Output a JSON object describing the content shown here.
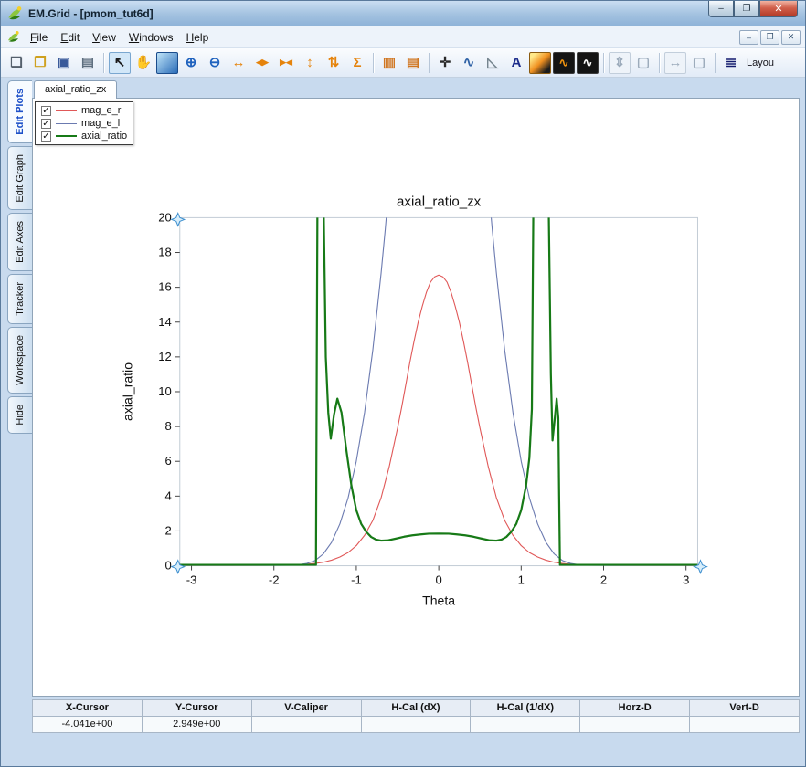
{
  "window": {
    "title": "EM.Grid - [pmom_tut6d]",
    "controls": {
      "minimize": "–",
      "maximize": "❐",
      "close": "✕"
    }
  },
  "child_controls": {
    "minimize": "–",
    "restore": "❐",
    "close": "✕"
  },
  "menu": {
    "items": [
      "File",
      "Edit",
      "View",
      "Windows",
      "Help"
    ]
  },
  "toolbar": {
    "icons": [
      {
        "name": "new-file",
        "glyph": "❏",
        "color": "#55606c"
      },
      {
        "name": "open-folder",
        "glyph": "❐",
        "color": "#cfa11f"
      },
      {
        "name": "save-file",
        "glyph": "▣",
        "color": "#3a5a9a"
      },
      {
        "name": "print",
        "glyph": "▤",
        "color": "#5e6e7e",
        "sep_after": true
      },
      {
        "name": "select-cursor",
        "glyph": "↖",
        "color": "#1c1c1c",
        "selected": true
      },
      {
        "name": "pan-hand",
        "glyph": "✋",
        "color": "#cc8b35"
      },
      {
        "name": "zoom-window",
        "glyph": "",
        "bluebox": true
      },
      {
        "name": "zoom-in",
        "glyph": "⊕",
        "color": "#1f62be"
      },
      {
        "name": "zoom-out",
        "glyph": "⊖",
        "color": "#1f62be"
      },
      {
        "name": "expand-x",
        "glyph": "↔",
        "color": "#e5830c"
      },
      {
        "name": "split-x",
        "glyph": "◀▶",
        "color": "#e5830c",
        "small": true
      },
      {
        "name": "center-x",
        "glyph": "▶◀",
        "color": "#e5830c",
        "small": true
      },
      {
        "name": "expand-y",
        "glyph": "↕",
        "color": "#e5830c"
      },
      {
        "name": "split-y",
        "glyph": "⇅",
        "color": "#e5830c"
      },
      {
        "name": "sum-sigma",
        "glyph": "Σ",
        "color": "#e5830c",
        "sep_after": true
      },
      {
        "name": "table-columns",
        "glyph": "▥",
        "color": "#d0751f"
      },
      {
        "name": "table-rows",
        "glyph": "▤",
        "color": "#d0751f",
        "sep_after": true
      },
      {
        "name": "crosshair",
        "glyph": "✛",
        "color": "#2a2a2a"
      },
      {
        "name": "axes-curve",
        "glyph": "∿",
        "color": "#2f62a6"
      },
      {
        "name": "delta-marker",
        "glyph": "◺",
        "color": "#76858f"
      },
      {
        "name": "text-tool",
        "glyph": "A",
        "color": "#1a2a8a"
      },
      {
        "name": "colormap",
        "glyph": "",
        "colormap": true
      },
      {
        "name": "waveform-filled",
        "glyph": "∿",
        "color": "#f0930f",
        "darkbg": true
      },
      {
        "name": "waveform-line",
        "glyph": "∿",
        "color": "#ffffff",
        "darkbg": true,
        "sep_after": true
      },
      {
        "name": "fit-vertical",
        "glyph": "⇕",
        "color": "#9cabbb",
        "boxed": true
      },
      {
        "name": "fit-window",
        "glyph": "▢",
        "color": "#9cabbb",
        "sep_after": true
      },
      {
        "name": "fit-horizontal",
        "glyph": "↔",
        "color": "#9cabbb",
        "boxed": true
      },
      {
        "name": "fit-window-2",
        "glyph": "▢",
        "color": "#9cabbb",
        "sep_after": true
      },
      {
        "name": "layout",
        "glyph": "≣",
        "color": "#131b6e",
        "label": "Layou"
      }
    ]
  },
  "sidebar": {
    "tabs": [
      {
        "label": "Edit Plots",
        "active": true
      },
      {
        "label": "Edit Graph",
        "active": false
      },
      {
        "label": "Edit Axes",
        "active": false
      },
      {
        "label": "Tracker",
        "active": false
      },
      {
        "label": "Workspace",
        "active": false
      },
      {
        "label": "Hide",
        "active": false
      }
    ]
  },
  "tabs": {
    "plot_tab": "axial_ratio_zx"
  },
  "legend": {
    "check_glyph": "✓",
    "items": [
      {
        "label": "mag_e_r",
        "color": "#e05858",
        "thickness": 1,
        "checked": true
      },
      {
        "label": "mag_e_l",
        "color": "#6b7ab0",
        "thickness": 1,
        "checked": true
      },
      {
        "label": "axial_ratio",
        "color": "#177a17",
        "thickness": 2,
        "checked": true
      }
    ]
  },
  "status_table": {
    "headers": [
      "X-Cursor",
      "Y-Cursor",
      "V-Caliper",
      "H-Cal (dX)",
      "H-Cal (1/dX)",
      "Horz-D",
      "Vert-D"
    ],
    "values": [
      "-4.041e+00",
      "2.949e+00",
      "",
      "",
      "",
      "",
      ""
    ]
  },
  "chart_data": {
    "type": "line",
    "title": "axial_ratio_zx",
    "xlabel": "Theta",
    "ylabel": "axial_ratio",
    "xlim": [
      -3.1416,
      3.1416
    ],
    "ylim": [
      0,
      20
    ],
    "xticks": [
      -3,
      -2,
      -1,
      0,
      1,
      2,
      3
    ],
    "yticks": [
      0,
      2,
      4,
      6,
      8,
      10,
      12,
      14,
      16,
      18,
      20
    ],
    "grid": false,
    "legend_position": "top-left-floating",
    "series": [
      {
        "name": "mag_e_r",
        "color": "#e05858",
        "width": 1.1,
        "points": [
          [
            -3.14,
            0.01
          ],
          [
            -2.6,
            0.01
          ],
          [
            -2.2,
            0.02
          ],
          [
            -2.0,
            0.03
          ],
          [
            -1.8,
            0.05
          ],
          [
            -1.6,
            0.09
          ],
          [
            -1.5,
            0.13
          ],
          [
            -1.4,
            0.2
          ],
          [
            -1.3,
            0.32
          ],
          [
            -1.2,
            0.5
          ],
          [
            -1.1,
            0.76
          ],
          [
            -1.0,
            1.15
          ],
          [
            -0.9,
            1.75
          ],
          [
            -0.8,
            2.6
          ],
          [
            -0.7,
            3.9
          ],
          [
            -0.6,
            5.7
          ],
          [
            -0.5,
            7.9
          ],
          [
            -0.45,
            9.1
          ],
          [
            -0.4,
            10.4
          ],
          [
            -0.35,
            11.7
          ],
          [
            -0.3,
            12.9
          ],
          [
            -0.25,
            14.0
          ],
          [
            -0.2,
            14.9
          ],
          [
            -0.15,
            15.7
          ],
          [
            -0.1,
            16.3
          ],
          [
            -0.05,
            16.6
          ],
          [
            0,
            16.7
          ],
          [
            0.05,
            16.6
          ],
          [
            0.1,
            16.3
          ],
          [
            0.15,
            15.7
          ],
          [
            0.2,
            14.9
          ],
          [
            0.25,
            14.0
          ],
          [
            0.3,
            12.9
          ],
          [
            0.35,
            11.7
          ],
          [
            0.4,
            10.4
          ],
          [
            0.45,
            9.1
          ],
          [
            0.5,
            7.9
          ],
          [
            0.6,
            5.7
          ],
          [
            0.7,
            3.9
          ],
          [
            0.8,
            2.6
          ],
          [
            0.9,
            1.75
          ],
          [
            1.0,
            1.15
          ],
          [
            1.1,
            0.76
          ],
          [
            1.2,
            0.5
          ],
          [
            1.3,
            0.32
          ],
          [
            1.4,
            0.2
          ],
          [
            1.5,
            0.13
          ],
          [
            1.6,
            0.09
          ],
          [
            1.8,
            0.05
          ],
          [
            2.0,
            0.03
          ],
          [
            2.2,
            0.02
          ],
          [
            2.6,
            0.01
          ],
          [
            3.14,
            0.01
          ]
        ]
      },
      {
        "name": "mag_e_l",
        "color": "#6b7ab0",
        "width": 1.1,
        "points": [
          [
            -3.14,
            0
          ],
          [
            -2.2,
            0
          ],
          [
            -2.0,
            0.01
          ],
          [
            -1.8,
            0.03
          ],
          [
            -1.7,
            0.06
          ],
          [
            -1.6,
            0.13
          ],
          [
            -1.5,
            0.3
          ],
          [
            -1.4,
            0.68
          ],
          [
            -1.3,
            1.35
          ],
          [
            -1.2,
            2.4
          ],
          [
            -1.1,
            3.9
          ],
          [
            -1.0,
            6.0
          ],
          [
            -0.9,
            8.8
          ],
          [
            -0.8,
            12.4
          ],
          [
            -0.7,
            16.8
          ],
          [
            -0.65,
            19.3
          ],
          [
            -0.6,
            22
          ],
          [
            -0.5,
            27
          ],
          [
            -0.4,
            32
          ],
          [
            -0.3,
            36.5
          ],
          [
            -0.2,
            39.5
          ],
          [
            -0.1,
            41.5
          ],
          [
            0,
            42
          ],
          [
            0.1,
            41.5
          ],
          [
            0.2,
            39.5
          ],
          [
            0.3,
            36.5
          ],
          [
            0.4,
            32
          ],
          [
            0.5,
            27
          ],
          [
            0.6,
            22
          ],
          [
            0.65,
            19.3
          ],
          [
            0.7,
            16.8
          ],
          [
            0.8,
            12.4
          ],
          [
            0.9,
            8.8
          ],
          [
            1.0,
            6.0
          ],
          [
            1.1,
            3.9
          ],
          [
            1.2,
            2.4
          ],
          [
            1.3,
            1.35
          ],
          [
            1.4,
            0.68
          ],
          [
            1.5,
            0.3
          ],
          [
            1.6,
            0.13
          ],
          [
            1.7,
            0.06
          ],
          [
            1.8,
            0.03
          ],
          [
            2.0,
            0.01
          ],
          [
            2.2,
            0
          ],
          [
            3.14,
            0
          ]
        ]
      },
      {
        "name": "axial_ratio",
        "color": "#177a17",
        "width": 2.2,
        "points": [
          [
            -3.14,
            0.05
          ],
          [
            -1.49,
            0.05
          ],
          [
            -1.48,
            12
          ],
          [
            -1.47,
            22
          ],
          [
            -1.4,
            22
          ],
          [
            -1.37,
            12
          ],
          [
            -1.34,
            8.8
          ],
          [
            -1.31,
            7.3
          ],
          [
            -1.27,
            8.7
          ],
          [
            -1.23,
            9.6
          ],
          [
            -1.18,
            8.8
          ],
          [
            -1.12,
            6.6
          ],
          [
            -1.06,
            4.6
          ],
          [
            -1.0,
            3.2
          ],
          [
            -0.94,
            2.4
          ],
          [
            -0.88,
            1.95
          ],
          [
            -0.82,
            1.65
          ],
          [
            -0.76,
            1.5
          ],
          [
            -0.7,
            1.44
          ],
          [
            -0.62,
            1.46
          ],
          [
            -0.52,
            1.56
          ],
          [
            -0.42,
            1.67
          ],
          [
            -0.32,
            1.75
          ],
          [
            -0.22,
            1.8
          ],
          [
            -0.12,
            1.84
          ],
          [
            0,
            1.85
          ],
          [
            0.12,
            1.84
          ],
          [
            0.22,
            1.8
          ],
          [
            0.32,
            1.75
          ],
          [
            0.42,
            1.67
          ],
          [
            0.52,
            1.56
          ],
          [
            0.62,
            1.46
          ],
          [
            0.7,
            1.44
          ],
          [
            0.76,
            1.5
          ],
          [
            0.82,
            1.65
          ],
          [
            0.88,
            1.95
          ],
          [
            0.94,
            2.4
          ],
          [
            1.0,
            3.2
          ],
          [
            1.06,
            4.6
          ],
          [
            1.1,
            6.2
          ],
          [
            1.13,
            9
          ],
          [
            1.15,
            22
          ],
          [
            1.33,
            22
          ],
          [
            1.36,
            11
          ],
          [
            1.38,
            7.2
          ],
          [
            1.41,
            8.6
          ],
          [
            1.43,
            9.6
          ],
          [
            1.45,
            8.5
          ],
          [
            1.46,
            4
          ],
          [
            1.47,
            0.05
          ],
          [
            3.14,
            0.05
          ]
        ]
      }
    ]
  }
}
